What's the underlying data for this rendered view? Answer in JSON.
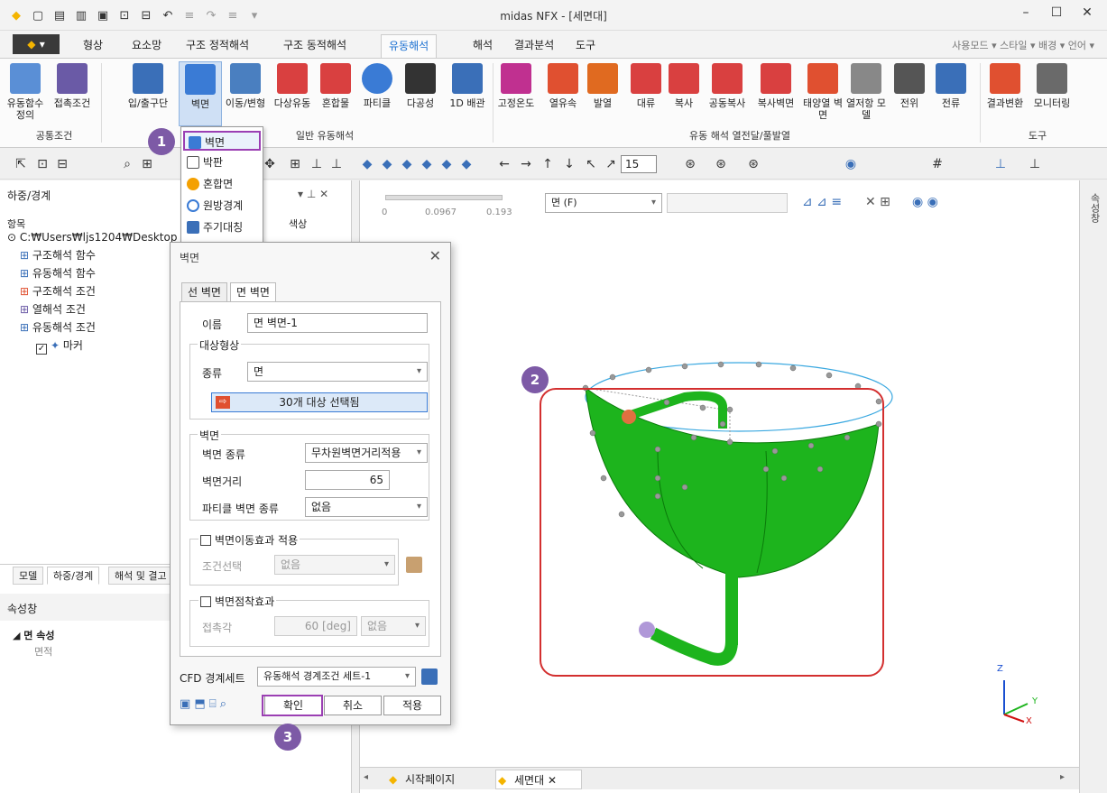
{
  "window": {
    "title": "midas NFX - [세면대]",
    "controls": [
      "–",
      "☐",
      "✕"
    ]
  },
  "menu": {
    "app_button": "▾",
    "tabs": [
      "형상",
      "요소망",
      "구조 정적해석",
      "구조 동적해석",
      "유동해석",
      "해석",
      "결과분석",
      "도구"
    ],
    "active_tab": "유동해석",
    "right": "사용모드  ▾ 스타일  ▾ 배경  ▾ 언어  ▾"
  },
  "ribbon": {
    "buttons": [
      {
        "label": "유동함수 정의",
        "color": "#5a8fd6"
      },
      {
        "label": "접촉조건",
        "color": "#6a5aa6"
      },
      {
        "label": "입/출구단",
        "color": "#3a6fb8"
      },
      {
        "label": "벽면",
        "color": "#3a7bd5"
      },
      {
        "label": "이동/변형",
        "color": "#4a7fc0"
      },
      {
        "label": "다상유동",
        "color": "#d94040"
      },
      {
        "label": "혼합물",
        "color": "#d94040"
      },
      {
        "label": "파티클",
        "color": "#3a7bd5"
      },
      {
        "label": "다공성",
        "color": "#333333"
      },
      {
        "label": "1D 배관",
        "color": "#3a6fb8"
      },
      {
        "label": "고정온도",
        "color": "#c03090"
      },
      {
        "label": "열유속",
        "color": "#e05030"
      },
      {
        "label": "발열",
        "color": "#e06a20"
      },
      {
        "label": "대류",
        "color": "#d94040"
      },
      {
        "label": "복사",
        "color": "#d94040"
      },
      {
        "label": "공동복사",
        "color": "#d94040"
      },
      {
        "label": "복사벽면",
        "color": "#d94040"
      },
      {
        "label": "태양열 벽면",
        "color": "#e05030"
      },
      {
        "label": "열저항 모델",
        "color": "#888888"
      },
      {
        "label": "전위",
        "color": "#555555"
      },
      {
        "label": "전류",
        "color": "#3a6fb8"
      },
      {
        "label": "결과변환",
        "color": "#e05030"
      },
      {
        "label": "모니터링",
        "color": "#6a6a6a"
      }
    ],
    "groups": [
      "공통조건",
      "일반 유동해석",
      "유동 해석 열전달/풀발열",
      "도구"
    ]
  },
  "toolbar": {
    "zoom_value": "15"
  },
  "left_panel": {
    "title": "하중/경계",
    "col_item": "항목",
    "col_color": "색상",
    "tree": [
      {
        "label": "C:₩Users₩ljs1204₩Desktop",
        "indent": 0
      },
      {
        "label": "구조해석 함수",
        "indent": 1
      },
      {
        "label": "유동해석 함수",
        "indent": 1
      },
      {
        "label": "구조해석 조건",
        "indent": 1
      },
      {
        "label": "열해석 조건",
        "indent": 1
      },
      {
        "label": "유동해석 조건",
        "indent": 1
      },
      {
        "label": "마커",
        "indent": 2
      }
    ],
    "bottom_tabs": [
      "모델",
      "하중/경계",
      "해석 및 결고"
    ],
    "prop_title": "속성창",
    "prop_section": "면 속성",
    "prop_item": "면적"
  },
  "wall_menu": {
    "items": [
      "벽면",
      "박판",
      "혼합면",
      "원방경계",
      "주기대칭"
    ]
  },
  "dialog": {
    "title": "벽면",
    "tabs": [
      "선 벽면",
      "면 벽면"
    ],
    "name_label": "이름",
    "name_value": "면 벽면-1",
    "target_group": "대상형상",
    "type_label": "종류",
    "type_value": "면",
    "select_button": "30개 대상 선택됨",
    "wall_group": "벽면",
    "wall_type_label": "벽면 종류",
    "wall_type_value": "무차원벽면거리적용",
    "wall_dist_label": "벽면거리",
    "wall_dist_value": "65",
    "particle_label": "파티클 벽면 종류",
    "particle_value": "없음",
    "motion_check": "벽면이동효과 적용",
    "cond_label": "조건선택",
    "cond_value": "없음",
    "adhesion_check": "벽면점착효과",
    "contact_label": "접촉각",
    "contact_value": "60 [deg]",
    "contact_unit_value": "없음",
    "cfd_label": "CFD 경계세트",
    "cfd_value": "유동해석 경계조건 세트-1",
    "ok": "확인",
    "cancel": "취소",
    "apply": "적용"
  },
  "viewport": {
    "legend": [
      "0",
      "0.0967",
      "0.193"
    ],
    "filter_value": "면 (F)",
    "doc_tabs": [
      "시작페이지",
      "세면대"
    ],
    "right_strip": "속성창"
  },
  "annotations": {
    "badge1": "1",
    "badge2": "2",
    "badge3": "3"
  },
  "axes": {
    "x": "X",
    "y": "Y",
    "z": "Z"
  }
}
